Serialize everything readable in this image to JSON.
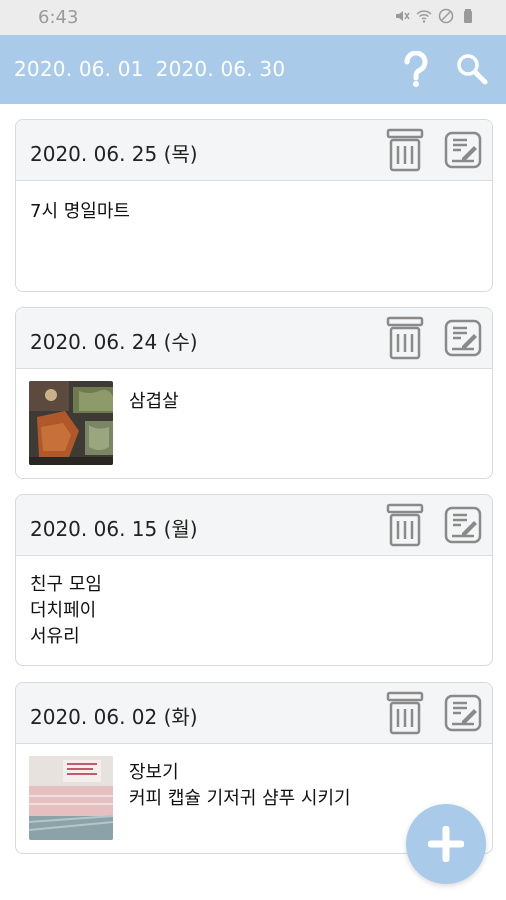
{
  "status": {
    "time": "6:43"
  },
  "header": {
    "start_date": "2020. 06. 01",
    "end_date": "2020. 06. 30"
  },
  "entries": [
    {
      "date": "2020. 06. 25 (목)",
      "lines": [
        "7시 명일마트"
      ],
      "has_photo": false
    },
    {
      "date": "2020. 06. 24 (수)",
      "lines": [
        "삼겹살"
      ],
      "has_photo": true
    },
    {
      "date": "2020. 06. 15 (월)",
      "lines": [
        "친구 모임",
        "더치페이",
        "서유리"
      ],
      "has_photo": false
    },
    {
      "date": "2020. 06. 02 (화)",
      "lines": [
        "장보기",
        "커피 캡슐 기저귀 샴푸 시키기"
      ],
      "has_photo": true
    }
  ],
  "icons": {
    "status": [
      "mute-icon",
      "wifi-icon",
      "do-not-disturb-icon",
      "battery-icon"
    ],
    "header": [
      "help-icon",
      "search-icon"
    ],
    "card": [
      "trash-icon",
      "edit-icon"
    ],
    "fab": "plus-icon"
  },
  "colors": {
    "app_bar": "#a9cbe9",
    "fab": "#a9cbe9",
    "card_header": "#f4f5f6"
  }
}
